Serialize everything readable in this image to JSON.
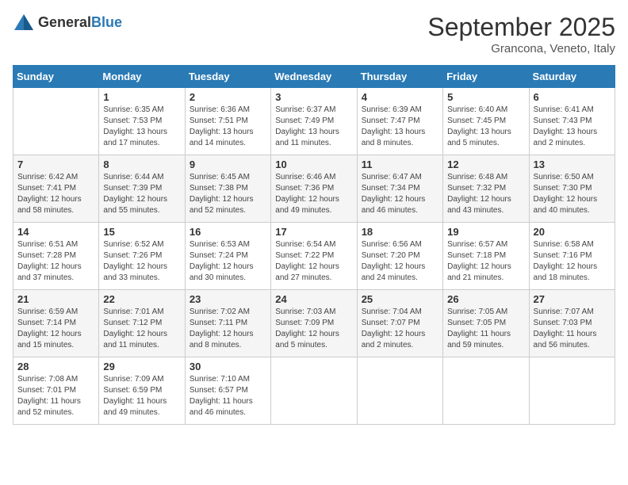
{
  "header": {
    "logo_general": "General",
    "logo_blue": "Blue",
    "month_year": "September 2025",
    "location": "Grancona, Veneto, Italy"
  },
  "weekdays": [
    "Sunday",
    "Monday",
    "Tuesday",
    "Wednesday",
    "Thursday",
    "Friday",
    "Saturday"
  ],
  "weeks": [
    [
      {
        "day": "",
        "info": ""
      },
      {
        "day": "1",
        "info": "Sunrise: 6:35 AM\nSunset: 7:53 PM\nDaylight: 13 hours\nand 17 minutes."
      },
      {
        "day": "2",
        "info": "Sunrise: 6:36 AM\nSunset: 7:51 PM\nDaylight: 13 hours\nand 14 minutes."
      },
      {
        "day": "3",
        "info": "Sunrise: 6:37 AM\nSunset: 7:49 PM\nDaylight: 13 hours\nand 11 minutes."
      },
      {
        "day": "4",
        "info": "Sunrise: 6:39 AM\nSunset: 7:47 PM\nDaylight: 13 hours\nand 8 minutes."
      },
      {
        "day": "5",
        "info": "Sunrise: 6:40 AM\nSunset: 7:45 PM\nDaylight: 13 hours\nand 5 minutes."
      },
      {
        "day": "6",
        "info": "Sunrise: 6:41 AM\nSunset: 7:43 PM\nDaylight: 13 hours\nand 2 minutes."
      }
    ],
    [
      {
        "day": "7",
        "info": "Sunrise: 6:42 AM\nSunset: 7:41 PM\nDaylight: 12 hours\nand 58 minutes."
      },
      {
        "day": "8",
        "info": "Sunrise: 6:44 AM\nSunset: 7:39 PM\nDaylight: 12 hours\nand 55 minutes."
      },
      {
        "day": "9",
        "info": "Sunrise: 6:45 AM\nSunset: 7:38 PM\nDaylight: 12 hours\nand 52 minutes."
      },
      {
        "day": "10",
        "info": "Sunrise: 6:46 AM\nSunset: 7:36 PM\nDaylight: 12 hours\nand 49 minutes."
      },
      {
        "day": "11",
        "info": "Sunrise: 6:47 AM\nSunset: 7:34 PM\nDaylight: 12 hours\nand 46 minutes."
      },
      {
        "day": "12",
        "info": "Sunrise: 6:48 AM\nSunset: 7:32 PM\nDaylight: 12 hours\nand 43 minutes."
      },
      {
        "day": "13",
        "info": "Sunrise: 6:50 AM\nSunset: 7:30 PM\nDaylight: 12 hours\nand 40 minutes."
      }
    ],
    [
      {
        "day": "14",
        "info": "Sunrise: 6:51 AM\nSunset: 7:28 PM\nDaylight: 12 hours\nand 37 minutes."
      },
      {
        "day": "15",
        "info": "Sunrise: 6:52 AM\nSunset: 7:26 PM\nDaylight: 12 hours\nand 33 minutes."
      },
      {
        "day": "16",
        "info": "Sunrise: 6:53 AM\nSunset: 7:24 PM\nDaylight: 12 hours\nand 30 minutes."
      },
      {
        "day": "17",
        "info": "Sunrise: 6:54 AM\nSunset: 7:22 PM\nDaylight: 12 hours\nand 27 minutes."
      },
      {
        "day": "18",
        "info": "Sunrise: 6:56 AM\nSunset: 7:20 PM\nDaylight: 12 hours\nand 24 minutes."
      },
      {
        "day": "19",
        "info": "Sunrise: 6:57 AM\nSunset: 7:18 PM\nDaylight: 12 hours\nand 21 minutes."
      },
      {
        "day": "20",
        "info": "Sunrise: 6:58 AM\nSunset: 7:16 PM\nDaylight: 12 hours\nand 18 minutes."
      }
    ],
    [
      {
        "day": "21",
        "info": "Sunrise: 6:59 AM\nSunset: 7:14 PM\nDaylight: 12 hours\nand 15 minutes."
      },
      {
        "day": "22",
        "info": "Sunrise: 7:01 AM\nSunset: 7:12 PM\nDaylight: 12 hours\nand 11 minutes."
      },
      {
        "day": "23",
        "info": "Sunrise: 7:02 AM\nSunset: 7:11 PM\nDaylight: 12 hours\nand 8 minutes."
      },
      {
        "day": "24",
        "info": "Sunrise: 7:03 AM\nSunset: 7:09 PM\nDaylight: 12 hours\nand 5 minutes."
      },
      {
        "day": "25",
        "info": "Sunrise: 7:04 AM\nSunset: 7:07 PM\nDaylight: 12 hours\nand 2 minutes."
      },
      {
        "day": "26",
        "info": "Sunrise: 7:05 AM\nSunset: 7:05 PM\nDaylight: 11 hours\nand 59 minutes."
      },
      {
        "day": "27",
        "info": "Sunrise: 7:07 AM\nSunset: 7:03 PM\nDaylight: 11 hours\nand 56 minutes."
      }
    ],
    [
      {
        "day": "28",
        "info": "Sunrise: 7:08 AM\nSunset: 7:01 PM\nDaylight: 11 hours\nand 52 minutes."
      },
      {
        "day": "29",
        "info": "Sunrise: 7:09 AM\nSunset: 6:59 PM\nDaylight: 11 hours\nand 49 minutes."
      },
      {
        "day": "30",
        "info": "Sunrise: 7:10 AM\nSunset: 6:57 PM\nDaylight: 11 hours\nand 46 minutes."
      },
      {
        "day": "",
        "info": ""
      },
      {
        "day": "",
        "info": ""
      },
      {
        "day": "",
        "info": ""
      },
      {
        "day": "",
        "info": ""
      }
    ]
  ]
}
